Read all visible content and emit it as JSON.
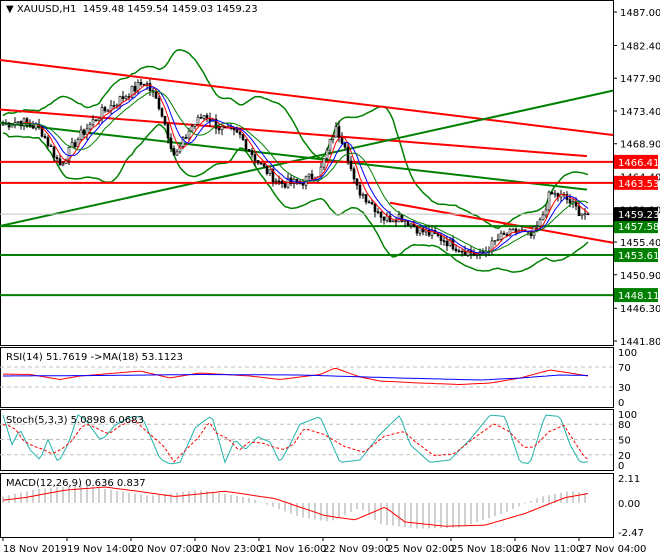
{
  "header": {
    "symbol": "XAUUSD,H1",
    "ohlc": "1459.48 1459.54 1459.03 1459.23"
  },
  "chart_data": {
    "type": "candlestick",
    "title": "XAUUSD,H1 1459.48 1459.54 1459.03 1459.23",
    "ylim": [
      1441.8,
      1487.0
    ],
    "price_ticks": [
      "1487.00",
      "1482.40",
      "1477.90",
      "1473.40",
      "1468.90",
      "1464.40",
      "1459.90",
      "1455.40",
      "1450.90",
      "1446.30",
      "1441.80"
    ],
    "price_path": [
      [
        0,
        1471.5
      ],
      [
        20,
        1472
      ],
      [
        40,
        1471
      ],
      [
        60,
        1466
      ],
      [
        80,
        1470
      ],
      [
        100,
        1473
      ],
      [
        120,
        1475
      ],
      [
        145,
        1477.5
      ],
      [
        160,
        1474
      ],
      [
        175,
        1467
      ],
      [
        190,
        1471
      ],
      [
        205,
        1473
      ],
      [
        220,
        1471
      ],
      [
        240,
        1470
      ],
      [
        260,
        1466
      ],
      [
        280,
        1463.5
      ],
      [
        300,
        1463.5
      ],
      [
        320,
        1465
      ],
      [
        335,
        1471
      ],
      [
        345,
        1469
      ],
      [
        355,
        1463
      ],
      [
        370,
        1461
      ],
      [
        385,
        1458.5
      ],
      [
        400,
        1459
      ],
      [
        420,
        1457
      ],
      [
        440,
        1456
      ],
      [
        460,
        1454.5
      ],
      [
        480,
        1453.5
      ],
      [
        500,
        1456
      ],
      [
        520,
        1457
      ],
      [
        530,
        1456
      ],
      [
        540,
        1458
      ],
      [
        550,
        1462
      ],
      [
        565,
        1461.5
      ],
      [
        580,
        1459.5
      ],
      [
        588,
        1459.23
      ]
    ],
    "levels": [
      {
        "price": 1466.41,
        "label": "1466.41",
        "color": "#ff0000"
      },
      {
        "price": 1463.53,
        "label": "1463.53",
        "color": "#ff0000"
      },
      {
        "price": 1457.58,
        "label": "1457.58",
        "color": "#008000"
      },
      {
        "price": 1453.61,
        "label": "1453.61",
        "color": "#008000"
      },
      {
        "price": 1448.11,
        "label": "1448.11",
        "color": "#008000"
      }
    ],
    "current": {
      "price": 1459.23,
      "label": "1459.23",
      "color": "#000000"
    },
    "trendlines": [
      {
        "from": [
          0,
          1480.4
        ],
        "to": [
          613,
          1470.1
        ],
        "color": "#ff0000"
      },
      {
        "from": [
          0,
          1473.6
        ],
        "to": [
          587,
          1467.2
        ],
        "color": "#ff0000"
      },
      {
        "from": [
          0,
          1457.6
        ],
        "to": [
          613,
          1476.2
        ],
        "color": "#008000"
      },
      {
        "from": [
          390,
          1460.8
        ],
        "to": [
          613,
          1455.3
        ],
        "color": "#ff0000"
      },
      {
        "from": [
          0,
          1471.8
        ],
        "to": [
          587,
          1462.6
        ],
        "color": "#008000"
      }
    ],
    "time_labels": [
      "18 Nov 2019",
      "19 Nov 14:00",
      "20 Nov 07:00",
      "20 Nov 23:00",
      "21 Nov 16:00",
      "22 Nov 09:00",
      "25 Nov 02:00",
      "25 Nov 18:00",
      "26 Nov 11:00",
      "27 Nov 04:00"
    ],
    "rsi": {
      "label": "RSI(14) 51.7619  ->MA(18) 53.1123",
      "ticks": [
        "100",
        "70",
        "30",
        "0"
      ],
      "line": [
        [
          0,
          56
        ],
        [
          30,
          55
        ],
        [
          60,
          45
        ],
        [
          80,
          52
        ],
        [
          140,
          62
        ],
        [
          170,
          48
        ],
        [
          200,
          58
        ],
        [
          250,
          52
        ],
        [
          280,
          45
        ],
        [
          320,
          55
        ],
        [
          335,
          68
        ],
        [
          360,
          50
        ],
        [
          380,
          42
        ],
        [
          420,
          38
        ],
        [
          460,
          35
        ],
        [
          490,
          38
        ],
        [
          520,
          48
        ],
        [
          550,
          64
        ],
        [
          570,
          58
        ],
        [
          588,
          52
        ]
      ],
      "ma": [
        [
          0,
          52
        ],
        [
          100,
          53
        ],
        [
          200,
          55
        ],
        [
          300,
          54
        ],
        [
          400,
          48
        ],
        [
          480,
          44
        ],
        [
          520,
          48
        ],
        [
          560,
          54
        ],
        [
          588,
          53
        ]
      ]
    },
    "stoch": {
      "label": "Stoch(5,3,3) 5.0898 6.0683",
      "ticks": [
        "100",
        "80",
        "50",
        "20",
        "0"
      ],
      "main": [
        [
          3,
          98
        ],
        [
          12,
          40
        ],
        [
          20,
          70
        ],
        [
          30,
          30
        ],
        [
          40,
          10
        ],
        [
          48,
          50
        ],
        [
          58,
          5
        ],
        [
          68,
          40
        ],
        [
          78,
          98
        ],
        [
          85,
          90
        ],
        [
          100,
          50
        ],
        [
          105,
          55
        ],
        [
          115,
          78
        ],
        [
          130,
          94
        ],
        [
          142,
          95
        ],
        [
          160,
          12
        ],
        [
          170,
          2
        ],
        [
          180,
          5
        ],
        [
          195,
          72
        ],
        [
          205,
          88
        ],
        [
          212,
          96
        ],
        [
          225,
          5
        ],
        [
          235,
          50
        ],
        [
          245,
          30
        ],
        [
          258,
          55
        ],
        [
          270,
          45
        ],
        [
          280,
          5
        ],
        [
          290,
          40
        ],
        [
          300,
          80
        ],
        [
          320,
          95
        ],
        [
          340,
          5
        ],
        [
          360,
          10
        ],
        [
          380,
          60
        ],
        [
          400,
          98
        ],
        [
          410,
          40
        ],
        [
          430,
          5
        ],
        [
          450,
          10
        ],
        [
          470,
          50
        ],
        [
          490,
          98
        ],
        [
          505,
          95
        ],
        [
          520,
          5
        ],
        [
          530,
          3
        ],
        [
          545,
          98
        ],
        [
          560,
          95
        ],
        [
          570,
          40
        ],
        [
          580,
          5
        ],
        [
          588,
          6
        ]
      ]
    },
    "macd": {
      "label": "MACD(12,26,9) 0.636 0.837",
      "ticks": [
        "2.11",
        "0.00",
        "-2.47"
      ],
      "ylim": [
        -2.47,
        2.11
      ],
      "hist": [
        [
          0,
          0.5
        ],
        [
          40,
          1.2
        ],
        [
          80,
          1.5
        ],
        [
          120,
          1.0
        ],
        [
          150,
          0.6
        ],
        [
          200,
          1.1
        ],
        [
          250,
          0.4
        ],
        [
          300,
          -1.2
        ],
        [
          330,
          -1.6
        ],
        [
          360,
          -0.4
        ],
        [
          380,
          -1.8
        ],
        [
          420,
          -2.2
        ],
        [
          460,
          -2.1
        ],
        [
          500,
          -1.0
        ],
        [
          540,
          0.5
        ],
        [
          570,
          1.0
        ],
        [
          588,
          0.8
        ]
      ]
    }
  }
}
